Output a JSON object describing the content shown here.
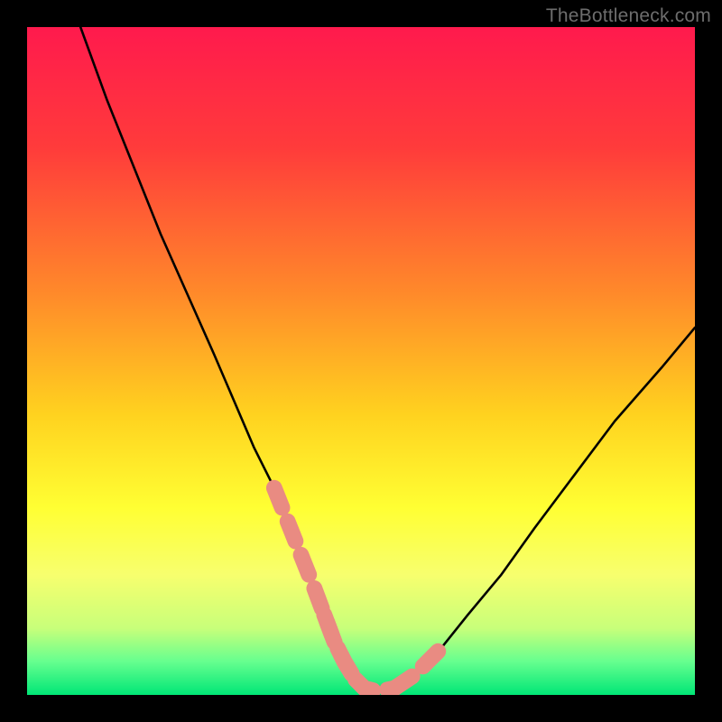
{
  "watermark": "TheBottleneck.com",
  "chart_data": {
    "type": "line",
    "title": "",
    "xlabel": "",
    "ylabel": "",
    "xlim": [
      0,
      100
    ],
    "ylim": [
      0,
      100
    ],
    "grid": false,
    "legend": false,
    "annotations": [],
    "background_gradient": {
      "stops": [
        {
          "offset": 0.0,
          "color": "#ff1a4d"
        },
        {
          "offset": 0.18,
          "color": "#ff3b3b"
        },
        {
          "offset": 0.4,
          "color": "#ff8a2a"
        },
        {
          "offset": 0.58,
          "color": "#ffd21f"
        },
        {
          "offset": 0.72,
          "color": "#ffff33"
        },
        {
          "offset": 0.82,
          "color": "#f7ff6e"
        },
        {
          "offset": 0.9,
          "color": "#c8ff7a"
        },
        {
          "offset": 0.95,
          "color": "#66ff8f"
        },
        {
          "offset": 1.0,
          "color": "#00e676"
        }
      ]
    },
    "series": [
      {
        "name": "bottleneck-curve",
        "color": "#000000",
        "x": [
          8,
          12,
          16,
          20,
          24,
          28,
          31,
          34,
          37,
          39,
          41,
          43,
          44.5,
          46,
          47.5,
          49,
          50.5,
          52.5,
          55,
          58,
          62,
          66,
          71,
          76,
          82,
          88,
          95,
          100
        ],
        "y": [
          100,
          89,
          79,
          69,
          60,
          51,
          44,
          37,
          31,
          26,
          21,
          16,
          12,
          8,
          5,
          2.5,
          1,
          0.5,
          1,
          3,
          7,
          12,
          18,
          25,
          33,
          41,
          49,
          55
        ]
      },
      {
        "name": "highlight-band-left",
        "color": "#e98b82",
        "x": [
          37,
          39,
          41,
          43,
          44.5,
          46,
          47.5,
          49,
          50.5
        ],
        "y": [
          31,
          26,
          21,
          16,
          12,
          8,
          5,
          2.5,
          1
        ]
      },
      {
        "name": "highlight-floor",
        "color": "#e98b82",
        "x": [
          44.5,
          46,
          47.5,
          49,
          50.5,
          52.5,
          55
        ],
        "y": [
          12,
          8,
          5,
          2.5,
          1,
          0.5,
          1
        ]
      },
      {
        "name": "highlight-band-right",
        "color": "#e98b82",
        "x": [
          55,
          58,
          60,
          62
        ],
        "y": [
          1,
          3,
          5,
          7
        ]
      }
    ]
  }
}
